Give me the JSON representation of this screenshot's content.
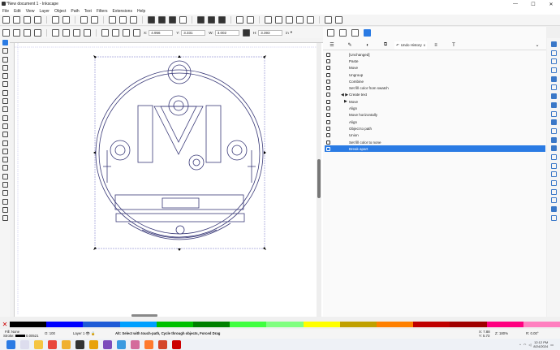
{
  "window": {
    "title": "*New document 1 - Inkscape"
  },
  "menu": [
    "File",
    "Edit",
    "View",
    "Layer",
    "Object",
    "Path",
    "Text",
    "Filters",
    "Extensions",
    "Help"
  ],
  "coords": {
    "x_label": "X:",
    "x": "4.956",
    "y_label": "Y:",
    "y": "3.331",
    "w_label": "W:",
    "w": "3.002",
    "h_label": "H:",
    "h": "3.393",
    "unit": "in"
  },
  "dock_tab": {
    "label": "Undo History",
    "close": "x"
  },
  "history": [
    {
      "label": "[Unchanged]"
    },
    {
      "label": "Paste"
    },
    {
      "label": "Move"
    },
    {
      "label": "Ungroup"
    },
    {
      "label": "Combine"
    },
    {
      "label": "Set fill color from swatch"
    },
    {
      "label": "Create text",
      "caret": "◀ ▶"
    },
    {
      "label": "Move",
      "caret": "▶"
    },
    {
      "label": "Align"
    },
    {
      "label": "Move horizontally"
    },
    {
      "label": "Align"
    },
    {
      "label": "Object to path"
    },
    {
      "label": "Union"
    },
    {
      "label": "Set fill color to none"
    },
    {
      "label": "Break apart",
      "selected": true
    }
  ],
  "status": {
    "fill_label": "Fill:",
    "fill_value": "None",
    "stroke_label": "Stroke:",
    "stroke_value": "0.00521",
    "opacity_label": "O:",
    "opacity_value": "100",
    "layer": "Layer 1",
    "message": "Alt: Select with touch-path, Cycle through objects, Forced Drag",
    "cursor_x_label": "X:",
    "cursor_x": "7.88",
    "cursor_y_label": "Y:",
    "cursor_y": "5.73",
    "zoom_label": "Z:",
    "zoom": "180%",
    "rotation_label": "R:",
    "rotation": "0.00°"
  },
  "clock": {
    "time": "12:12 PM",
    "date": "8/24/2024"
  },
  "palette_colors": [
    "#000000",
    "#0000ff",
    "#1f5bd6",
    "#00a0ff",
    "#00c000",
    "#008000",
    "#40ff40",
    "#80ff80",
    "#ffff00",
    "#c0a000",
    "#ff8000",
    "#c00000",
    "#a00000",
    "#ff0080",
    "#ff80c0"
  ]
}
